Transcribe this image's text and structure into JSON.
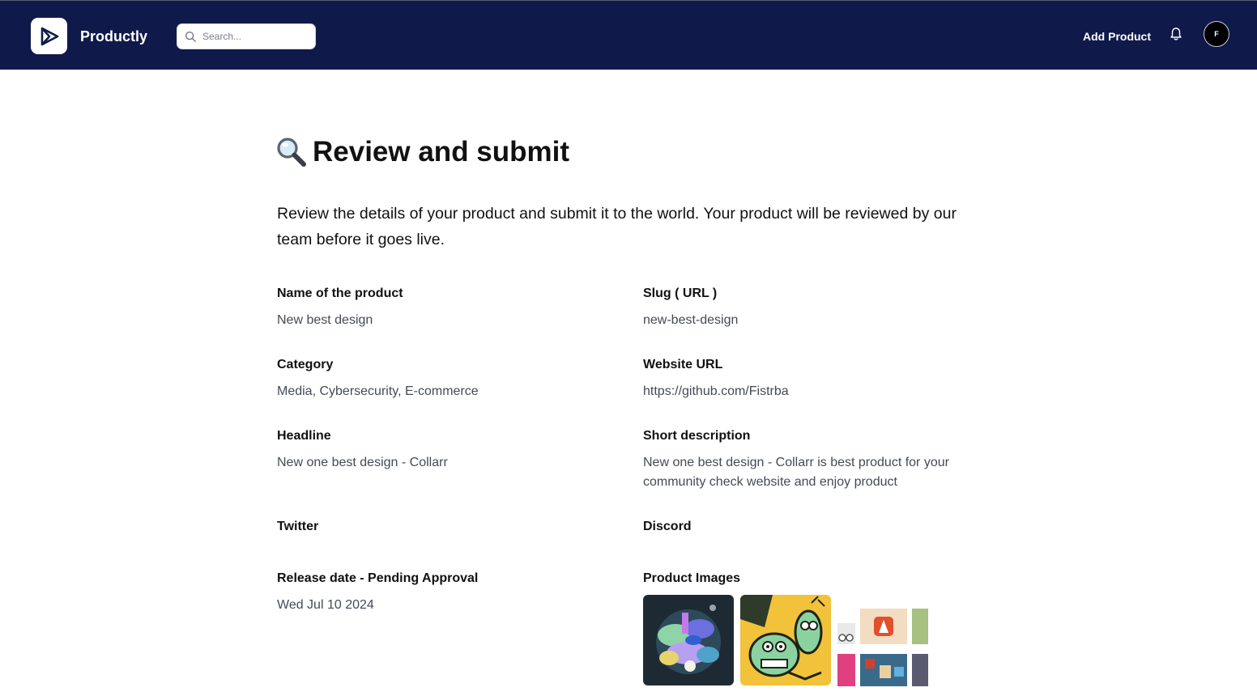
{
  "app": {
    "name": "Productly"
  },
  "header": {
    "search_placeholder": "Search...",
    "add_product_label": "Add Product",
    "avatar_initial": "F"
  },
  "page": {
    "title": "Review and submit",
    "title_icon": "magnifying-glass-emoji",
    "intro": "Review the details of your product and submit it to the world. Your product will be reviewed by our team before it goes live."
  },
  "fields": {
    "name": {
      "label": "Name of the product",
      "value": "New best design"
    },
    "slug": {
      "label": "Slug ( URL )",
      "value": "new-best-design"
    },
    "category": {
      "label": "Category",
      "value": "Media, Cybersecurity, E-commerce"
    },
    "website": {
      "label": "Website URL",
      "value": "https://github.com/Fistrba"
    },
    "headline": {
      "label": "Headline",
      "value": "New one best design - Collarr"
    },
    "short_description": {
      "label": "Short description",
      "value": "New one best design - Collarr is best product for your community check website and enjoy product"
    },
    "twitter": {
      "label": "Twitter",
      "value": ""
    },
    "discord": {
      "label": "Discord",
      "value": ""
    },
    "release_date": {
      "label": "Release date - Pending Approval",
      "value": "Wed Jul 10 2024"
    },
    "product_images": {
      "label": "Product Images"
    }
  },
  "colors": {
    "header_bg": "#101a4a",
    "text": "#111111",
    "muted": "#444a55"
  }
}
